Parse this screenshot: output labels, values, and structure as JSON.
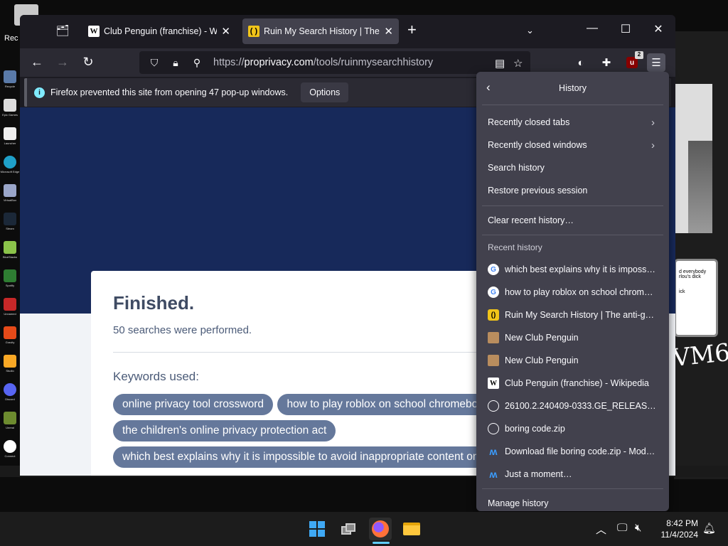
{
  "desktop": {
    "top_label": "Rec",
    "icon_labels": [
      "Recycle",
      "Epic Games",
      "Launcher",
      "Microsoft Edge",
      "VirtualBox",
      "Steam",
      "BlueStacks",
      "Spotify",
      "Discord",
      "Unnamed",
      "Gravity",
      "Studio",
      "Unreal",
      "Connect"
    ],
    "note_text": "d everybody\nrlou's dick\n\n\nick",
    "scribble": "VM6"
  },
  "browser": {
    "tabs": [
      {
        "title": "Club Penguin (franchise) - Wiki",
        "favicon": "W"
      },
      {
        "title": "Ruin My Search History | The ar",
        "favicon": "( )"
      }
    ],
    "new_tab": "+",
    "url_prefix": "https://",
    "url_host": "proprivacy.com",
    "url_path": "/tools/ruinmysearchhistory",
    "ublock_badge": "2",
    "notification": {
      "message": "Firefox prevented this site from opening 47 pop-up windows.",
      "button": "Options"
    }
  },
  "page": {
    "title": "Finished.",
    "subtitle": "50 searches were performed.",
    "keywords_label": "Keywords used:",
    "keywords": [
      "online privacy tool crossword",
      "how to play roblox on school chromebook",
      "the children's online privacy protection act",
      "which best explains why it is impossible to avoid inappropriate content online"
    ]
  },
  "history_menu": {
    "title": "History",
    "items": [
      "Recently closed tabs",
      "Recently closed windows",
      "Search history",
      "Restore previous session"
    ],
    "clear": "Clear recent history…",
    "recent_label": "Recent history",
    "recent": [
      {
        "icon": "google",
        "title": "which best explains why it is impossibl…"
      },
      {
        "icon": "google",
        "title": "how to play roblox on school chromeb…"
      },
      {
        "icon": "ruin",
        "title": "Ruin My Search History | The anti-goo…"
      },
      {
        "icon": "penguin",
        "title": "New Club Penguin"
      },
      {
        "icon": "penguin",
        "title": "New Club Penguin"
      },
      {
        "icon": "wikipedia",
        "title": "Club Penguin (franchise) - Wikipedia"
      },
      {
        "icon": "globe",
        "title": "26100.2.240409-0333.GE_RELEASE_SVC_…"
      },
      {
        "icon": "globe",
        "title": "boring code.zip"
      },
      {
        "icon": "modsfire",
        "title": "Download file boring code.zip - ModsF…"
      },
      {
        "icon": "modsfire",
        "title": "Just a moment…"
      }
    ],
    "manage": "Manage history"
  },
  "taskbar": {
    "time": "8:42 PM",
    "date": "11/4/2024"
  },
  "colors": {
    "hero": "#17295a",
    "pill": "#65789b",
    "menu_bg": "#42414d"
  }
}
